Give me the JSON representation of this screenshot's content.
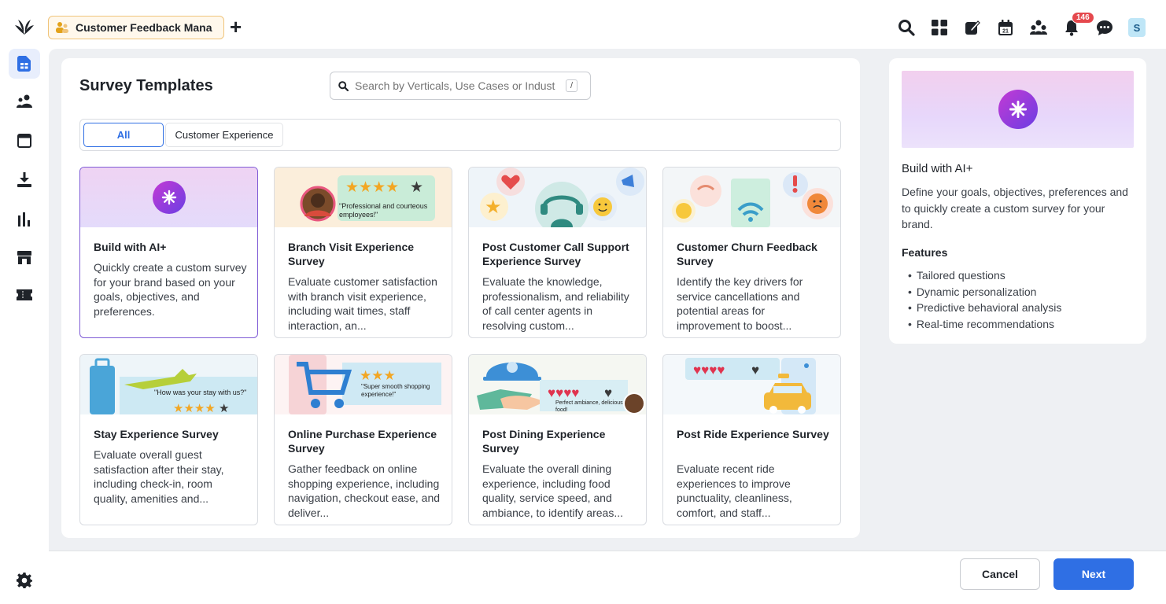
{
  "app": {
    "tab_label": "Customer Feedback Mana",
    "add_tab": "+",
    "notification_count": "146",
    "user_initial": "S"
  },
  "panel": {
    "title": "Survey Templates",
    "search_placeholder": "Search by Verticals, Use Cases or Indust",
    "search_shortcut": "/",
    "filters": [
      "All",
      "Customer Experience"
    ]
  },
  "cards": [
    {
      "title": "Build with AI+",
      "desc": "Quickly create a custom survey for your brand based on your goals, objectives, and preferences."
    },
    {
      "title": "Branch Visit Experience Survey",
      "desc": "Evaluate customer satisfaction with branch visit experience, including wait times, staff interaction, an...",
      "banner_text": "\"Professional and courteous employees!\""
    },
    {
      "title": "Post Customer Call Support Experience Survey",
      "desc": "Evaluate the knowledge, professionalism, and reliability of call center agents in resolving custom..."
    },
    {
      "title": "Customer Churn Feedback Survey",
      "desc": "Identify the key drivers for service cancellations and potential areas for improvement to boost..."
    },
    {
      "title": "Stay Experience Survey",
      "desc": "Evaluate overall guest satisfaction after their stay, including check-in, room quality, amenities and...",
      "banner_text": "\"How was your stay with us?\""
    },
    {
      "title": "Online Purchase Experience Survey",
      "desc": "Gather feedback on online shopping experience, including navigation, checkout ease, and deliver...",
      "banner_text": "\"Super smooth shopping experience!\""
    },
    {
      "title": "Post Dining Experience Survey",
      "desc": "Evaluate the overall dining experience, including food quality, service speed, and ambiance, to identify areas...",
      "banner_text": "Perfect ambiance, delicious food!"
    },
    {
      "title": "Post Ride Experience Survey",
      "desc": "Evaluate recent ride experiences to improve punctuality, cleanliness, comfort, and staff..."
    }
  ],
  "detail": {
    "title": "Build with AI+",
    "desc": "Define your goals, objectives, preferences and to quickly create a custom survey for your brand.",
    "features_heading": "Features",
    "features": [
      "Tailored questions",
      "Dynamic personalization",
      "Predictive behavioral analysis",
      "Real-time recommendations"
    ]
  },
  "footer": {
    "cancel": "Cancel",
    "next": "Next"
  },
  "colors": {
    "primary": "#2f6fe4",
    "ai_gradient_start": "#c33ad4",
    "ai_gradient_end": "#6b3ee3",
    "badge": "#e5484d"
  },
  "icons": [
    "sprout-logo-icon",
    "group-icon",
    "search-icon",
    "grid-icon",
    "compose-icon",
    "calendar-icon",
    "team-icon",
    "bell-icon",
    "chat-icon",
    "document-icon",
    "people-icon",
    "window-icon",
    "download-icon",
    "bar-chart-icon",
    "store-icon",
    "ticket-icon",
    "gear-icon",
    "ai-sparkle-icon"
  ]
}
